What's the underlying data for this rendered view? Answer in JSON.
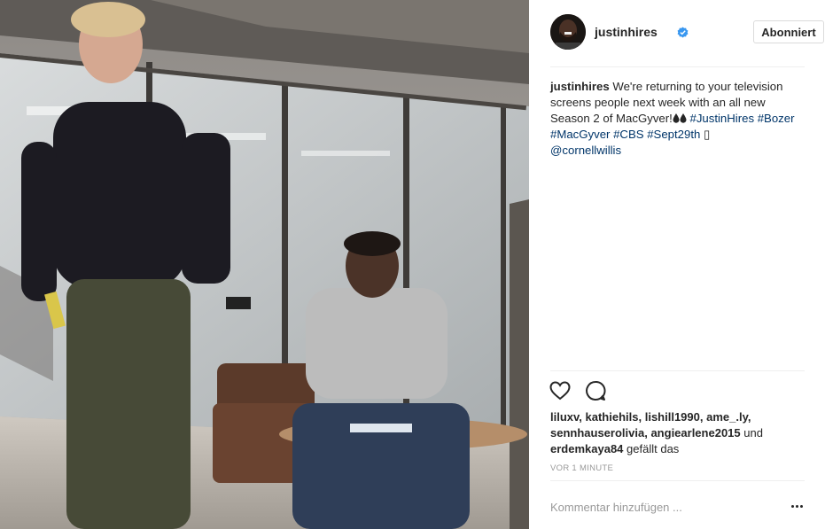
{
  "post": {
    "username": "justinhires",
    "verified": true,
    "follow_button": "Abonniert",
    "caption": {
      "user": "justinhires",
      "text_1": "We're returning to your television screens people next week with an all new Season 2 of MacGyver!",
      "drop_icons": [
        "drop-icon",
        "drop-icon"
      ],
      "hashtags": [
        "#JustinHires",
        "#Bozer",
        "#MacGyver",
        "#CBS",
        "#Sept29th"
      ],
      "emoji_icon": "box-glyph",
      "mention": "@cornellwillis"
    },
    "actions": {
      "like_icon": "heart-icon",
      "comment_icon": "comment-icon"
    },
    "likes": {
      "users": [
        "liluxv",
        "kathiehils",
        "lishill1990",
        "ame_.ly",
        "sennhauserolivia",
        "angiearlene2015"
      ],
      "and_word": "und",
      "last_user": "erdemkaya84",
      "suffix": "gefällt das"
    },
    "timestamp": "VOR 1 MINUTE",
    "comment_box": {
      "placeholder": "Kommentar hinzufügen ..."
    },
    "more_icon": "ellipsis-icon",
    "colors": {
      "link": "#003569",
      "verified": "#3897f0",
      "muted": "#999999",
      "divider": "#efefef"
    }
  }
}
